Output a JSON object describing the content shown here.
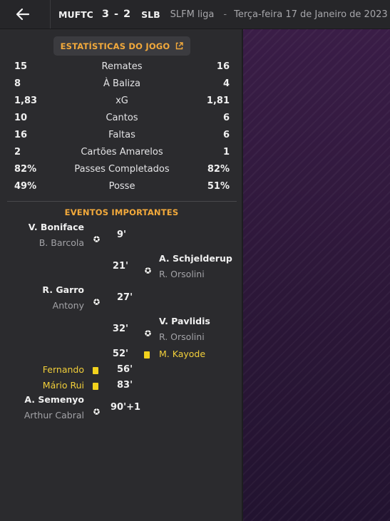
{
  "header": {
    "home_team": "MUFTC",
    "score": "3 - 2",
    "away_team": "SLB",
    "league": "SLFM liga",
    "separator": "-",
    "date": "Terça-feira 17 de Janeiro de 2023"
  },
  "stats_button": {
    "label": "ESTATÍSTICAS DO JOGO",
    "icon": "external-link-icon"
  },
  "stats": [
    {
      "label": "Remates",
      "home": "15",
      "away": "16"
    },
    {
      "label": "À Baliza",
      "home": "8",
      "away": "4"
    },
    {
      "label": "xG",
      "home": "1,83",
      "away": "1,81"
    },
    {
      "label": "Cantos",
      "home": "10",
      "away": "6"
    },
    {
      "label": "Faltas",
      "home": "16",
      "away": "6"
    },
    {
      "label": "Cartões Amarelos",
      "home": "2",
      "away": "1"
    },
    {
      "label": "Passes Completados",
      "home": "82%",
      "away": "82%"
    },
    {
      "label": "Posse",
      "home": "49%",
      "away": "51%"
    }
  ],
  "events_title": "EVENTOS IMPORTANTES",
  "events": [
    {
      "side": "home",
      "type": "goal",
      "minute": "9'",
      "player": "V. Boniface",
      "assist": "B. Barcola"
    },
    {
      "side": "away",
      "type": "goal",
      "minute": "21'",
      "player": "A. Schjelderup",
      "assist": "R. Orsolini"
    },
    {
      "side": "home",
      "type": "goal",
      "minute": "27'",
      "player": "R. Garro",
      "assist": "Antony"
    },
    {
      "side": "away",
      "type": "goal",
      "minute": "32'",
      "player": "V. Pavlidis",
      "assist": "R. Orsolini"
    },
    {
      "side": "away",
      "type": "yellow-card",
      "minute": "52'",
      "player": "M. Kayode"
    },
    {
      "side": "home",
      "type": "yellow-card",
      "minute": "56'",
      "player": "Fernando"
    },
    {
      "side": "home",
      "type": "yellow-card",
      "minute": "83'",
      "player": "Mário Rui"
    },
    {
      "side": "home",
      "type": "goal",
      "minute": "90'+1",
      "player": "A. Semenyo",
      "assist": "Arthur Cabral"
    }
  ],
  "colors": {
    "accent": "#f2a93b",
    "yellow_card": "#f2d21d",
    "panel": "#2b2b2e",
    "side_purple": "#3a1d47"
  }
}
